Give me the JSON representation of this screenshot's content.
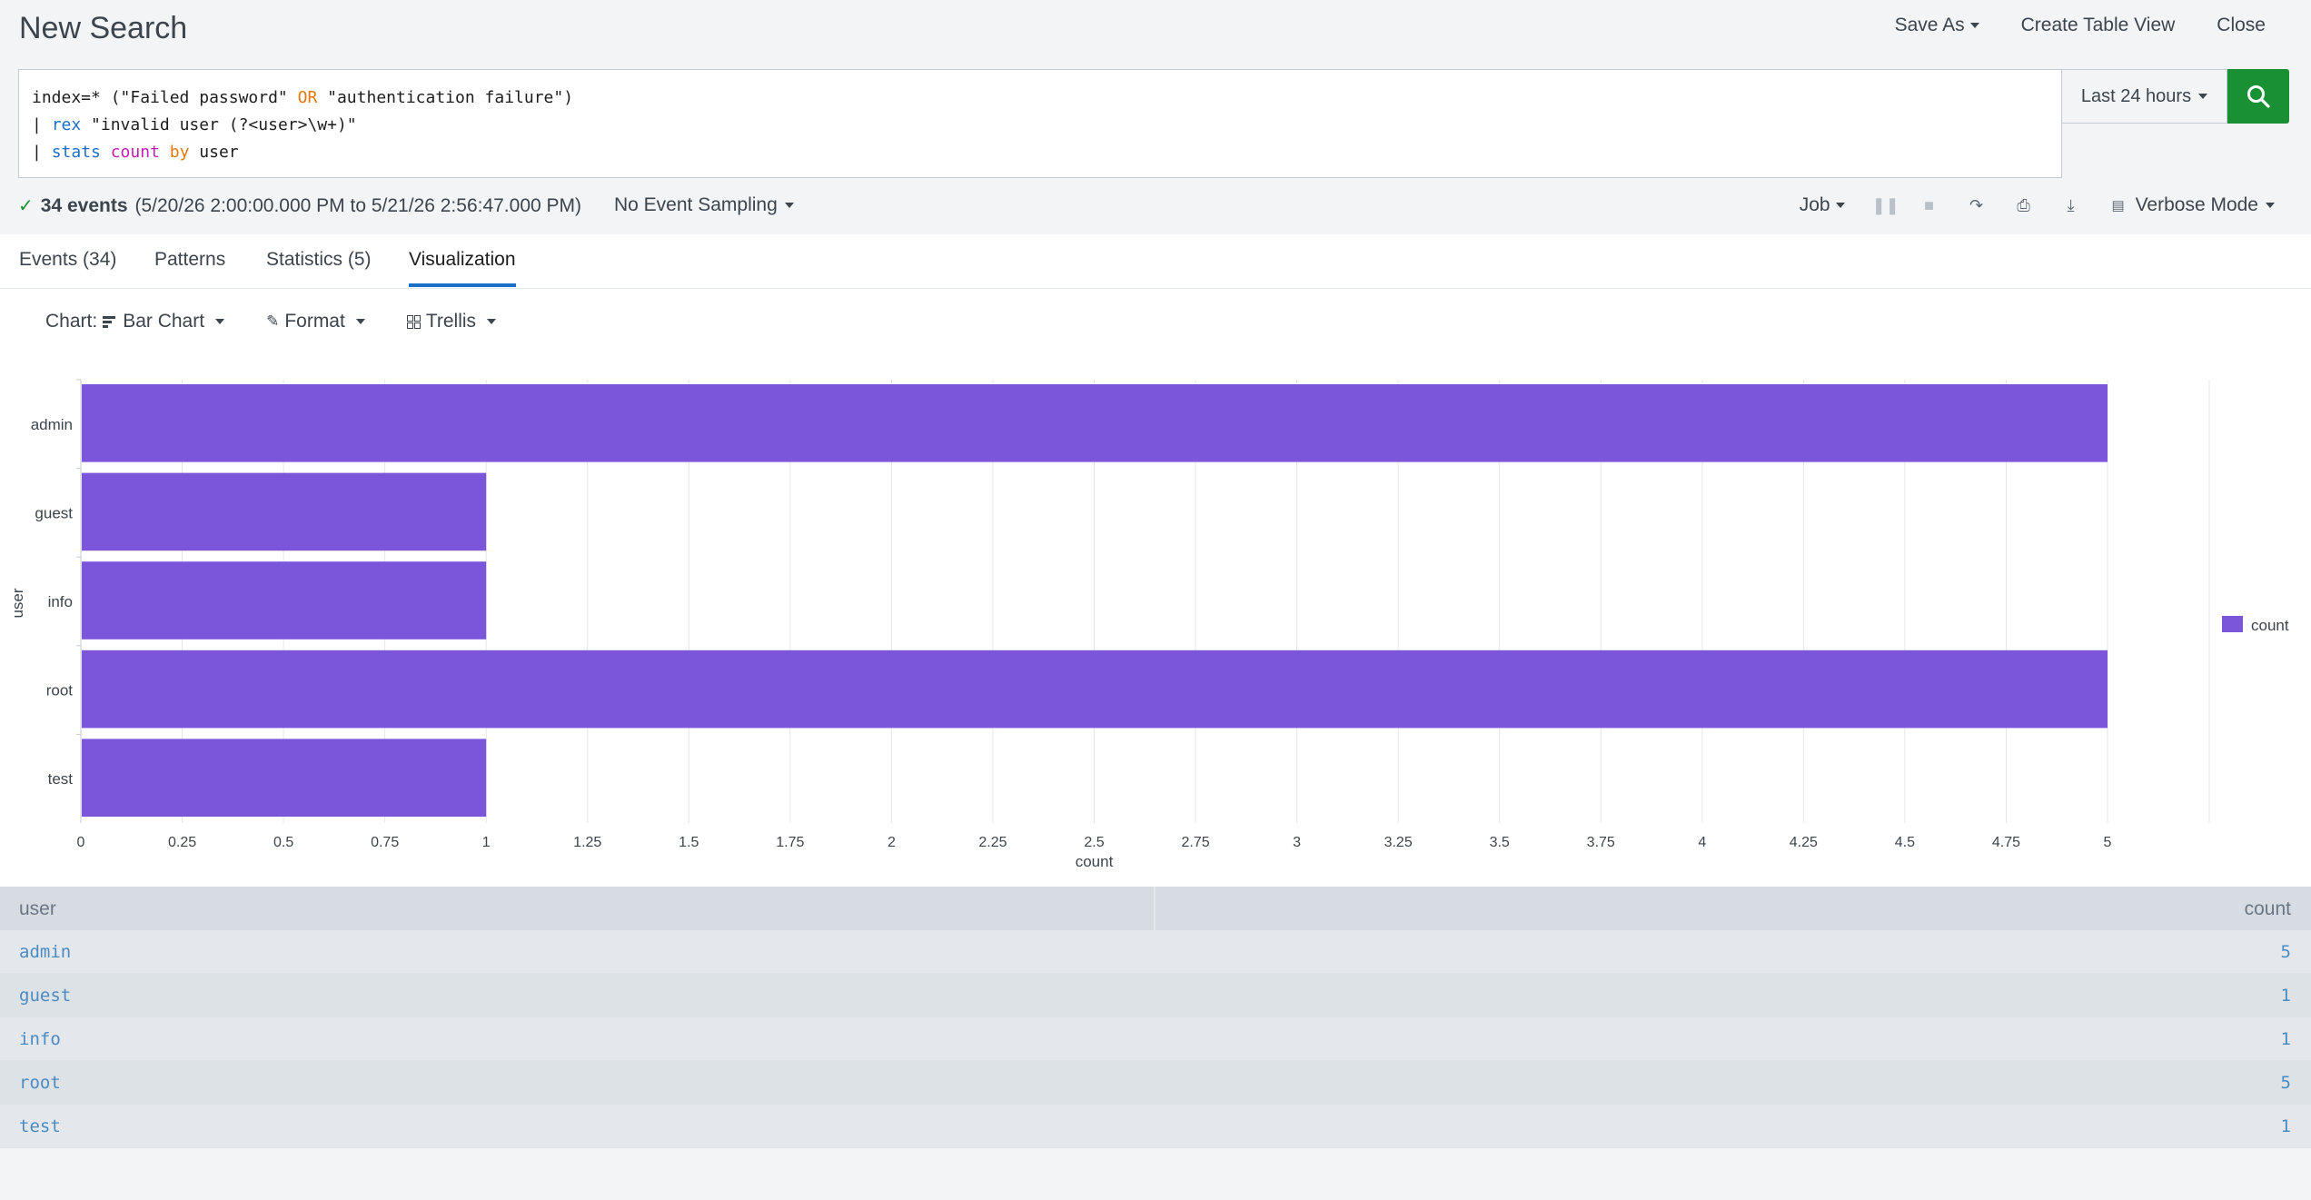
{
  "header": {
    "title": "New Search",
    "save_as": "Save As",
    "create_table_view": "Create Table View",
    "close": "Close"
  },
  "search": {
    "line1_a": "index=* (\"Failed password\" ",
    "line1_or": "OR",
    "line1_b": " \"authentication failure\")",
    "line2_pipe": "| ",
    "line2_cmd": "rex",
    "line2_rest": " \"invalid user (?<user>\\w+)\"",
    "line3_pipe": "| ",
    "line3_cmd": "stats",
    "line3_fn": "count",
    "line3_by": "by",
    "line3_field": "user",
    "time_range": "Last 24 hours"
  },
  "status": {
    "events_count": "34 events",
    "range": "(5/20/26 2:00:00.000 PM to 5/21/26 2:56:47.000 PM)",
    "sampling": "No Event Sampling",
    "job": "Job",
    "mode": "Verbose Mode"
  },
  "tabs": [
    {
      "label": "Events (34)"
    },
    {
      "label": "Patterns"
    },
    {
      "label": "Statistics (5)"
    },
    {
      "label": "Visualization"
    }
  ],
  "viz_toolbar": {
    "chart_label": "Chart:",
    "chart_type": "Bar Chart",
    "format": "Format",
    "trellis": "Trellis"
  },
  "colors": {
    "bar": "#7b56db",
    "accent": "#1a6fc9",
    "search_green": "#1a9035"
  },
  "chart_data": {
    "type": "bar",
    "orientation": "horizontal",
    "categories": [
      "admin",
      "guest",
      "info",
      "root",
      "test"
    ],
    "series": [
      {
        "name": "count",
        "values": [
          5,
          1,
          1,
          5,
          1
        ]
      }
    ],
    "xlabel": "count",
    "ylabel": "user",
    "xlim": [
      0,
      5
    ],
    "ticks": [
      "0",
      "0.25",
      "0.5",
      "0.75",
      "1",
      "1.25",
      "1.5",
      "1.75",
      "2",
      "2.25",
      "2.5",
      "2.75",
      "3",
      "3.25",
      "3.5",
      "3.75",
      "4",
      "4.25",
      "4.5",
      "4.75",
      "5"
    ],
    "grid": true,
    "legend": "right"
  },
  "table": {
    "columns": [
      "user",
      "count"
    ],
    "rows": [
      [
        "admin",
        "5"
      ],
      [
        "guest",
        "1"
      ],
      [
        "info",
        "1"
      ],
      [
        "root",
        "5"
      ],
      [
        "test",
        "1"
      ]
    ]
  }
}
